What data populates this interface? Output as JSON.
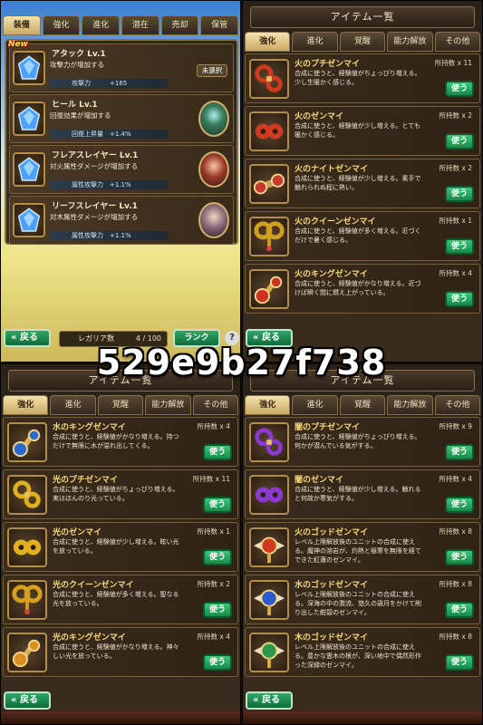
{
  "overlay_text": "529e9b27f738",
  "panel1": {
    "tabs": [
      "装備",
      "強化",
      "進化",
      "潜在",
      "売却",
      "保管"
    ],
    "skills": [
      {
        "name": "アタック Lv.1",
        "desc": "攻撃力が増加する",
        "stat_label": "攻撃力",
        "stat_value": "+165",
        "new": true,
        "new_label": "New",
        "right": "unselected",
        "right_label": "未選択",
        "icon": "blue-crystal-icon"
      },
      {
        "name": "ヒール Lv.1",
        "desc": "回復効果が増加する",
        "stat_label": "回復上昇量",
        "stat_value": "+1.4%",
        "right": "portrait",
        "icon": "blue-crystal-icon"
      },
      {
        "name": "フレアスレイヤー Lv.1",
        "desc": "対火属性ダメージが増加する",
        "stat_label": "属性攻撃力",
        "stat_value": "+1.1%",
        "right": "portrait",
        "icon": "blue-crystal-icon"
      },
      {
        "name": "リーフスレイヤー Lv.1",
        "desc": "対木属性ダメージが増加する",
        "stat_label": "属性攻撃力",
        "stat_value": "+1.1%",
        "right": "portrait",
        "icon": "blue-crystal-icon"
      }
    ],
    "back_label": "戻る",
    "regalia_label": "レガリア数",
    "regalia_count": "4 / 100",
    "rank_label": "ランク",
    "help_label": "?"
  },
  "item_tabs": [
    "強化",
    "進化",
    "覚醒",
    "能力解放",
    "その他"
  ],
  "item_title": "アイテム一覧",
  "use_label": "使う",
  "back_label": "戻る",
  "panel2": {
    "items": [
      {
        "name": "火のプチゼンマイ",
        "owned": "所持数 x 11",
        "desc": "合成に使うと、経験値がちょっぴり増える。少し生暖かく感じる。",
        "color": "#d03a20",
        "icon": "small-key-icon"
      },
      {
        "name": "火のゼンマイ",
        "owned": "所持数 x 2",
        "desc": "合成に使うと、経験値が少し増える。とても暖かく感じる。",
        "color": "#d03a20",
        "icon": "gear-icon"
      },
      {
        "name": "火のナイトゼンマイ",
        "owned": "所持数 x 2",
        "desc": "合成に使うと、経験値が少し増える。素手で触れられぬ程に熱い。",
        "color": "#c83a30",
        "icon": "knight-key-icon"
      },
      {
        "name": "火のクイーンゼンマイ",
        "owned": "所持数 x 1",
        "desc": "合成に使うと、経験値が多く増える。近づくだけで暑く感じる。",
        "color": "#d0a020",
        "icon": "queen-key-icon"
      },
      {
        "name": "火のキングゼンマイ",
        "owned": "所持数 x 4",
        "desc": "合成に使うと、経験値がかなり増える。近づけば瞬く間に燃え上がっている。",
        "color": "#d03020",
        "icon": "king-key-icon"
      }
    ]
  },
  "panel3": {
    "items": [
      {
        "name": "水のキングゼンマイ",
        "owned": "所持数 x 4",
        "desc": "合成に使うと、経験値がかなり増える。持つだけで無限に水が溢れ出してくる。",
        "color": "#2a6ad0",
        "icon": "king-key-icon"
      },
      {
        "name": "光のプチゼンマイ",
        "owned": "所持数 x 11",
        "desc": "合成に使うと、経験値がちょっぴり増える。実はほんのり光っている。",
        "color": "#e0b020",
        "icon": "small-key-icon"
      },
      {
        "name": "光のゼンマイ",
        "owned": "所持数 x 1",
        "desc": "合成に使うと、経験値が少し増える。眩い光を放っている。",
        "color": "#e0b020",
        "icon": "gear-icon"
      },
      {
        "name": "光のクイーンゼンマイ",
        "owned": "所持数 x 2",
        "desc": "合成に使うと、経験値が多く増える。聖なる光を放っている。",
        "color": "#d8a020",
        "icon": "queen-key-icon"
      },
      {
        "name": "光のキングゼンマイ",
        "owned": "所持数 x 4",
        "desc": "合成に使うと、経験値がかなり増える。神々しい光を放っている。",
        "color": "#d89020",
        "icon": "king-key-icon"
      }
    ]
  },
  "panel4": {
    "items": [
      {
        "name": "闇のプチゼンマイ",
        "owned": "所持数 x 9",
        "desc": "合成に使うと、経験値がちょっぴり増える。何かが潜んでいる気がする。",
        "color": "#8a3ad0",
        "icon": "small-key-icon"
      },
      {
        "name": "闇のゼンマイ",
        "owned": "所持数 x 4",
        "desc": "合成に使うと、経験値が少し増える。触れると何故か寒気がする。",
        "color": "#8a3ad0",
        "icon": "gear-icon"
      },
      {
        "name": "火のゴッドゼンマイ",
        "owned": "所持数 x 8",
        "desc": "レベル上限解放後のユニットの合成に使える。魔神の溶岩が、灼熱と極寒を無限を経てできた紅蓮のゼンマイ。",
        "color": "#d03a20",
        "icon": "god-key-icon"
      },
      {
        "name": "水のゴッドゼンマイ",
        "owned": "所持数 x 8",
        "desc": "レベル上限解放後のユニットの合成に使える。深海の中の激流、悠久の歳月をかけて削り出した紺碧のゼンマイ。",
        "color": "#2a5ad0",
        "icon": "god-key-icon"
      },
      {
        "name": "木のゴッドゼンマイ",
        "owned": "所持数 x 8",
        "desc": "レベル上限解放後のユニットの合成に使える。豊かな霊木の根が、深い地中で偶然形作った深緑のゼンマイ。",
        "color": "#2a9a4a",
        "icon": "god-key-icon"
      }
    ]
  }
}
